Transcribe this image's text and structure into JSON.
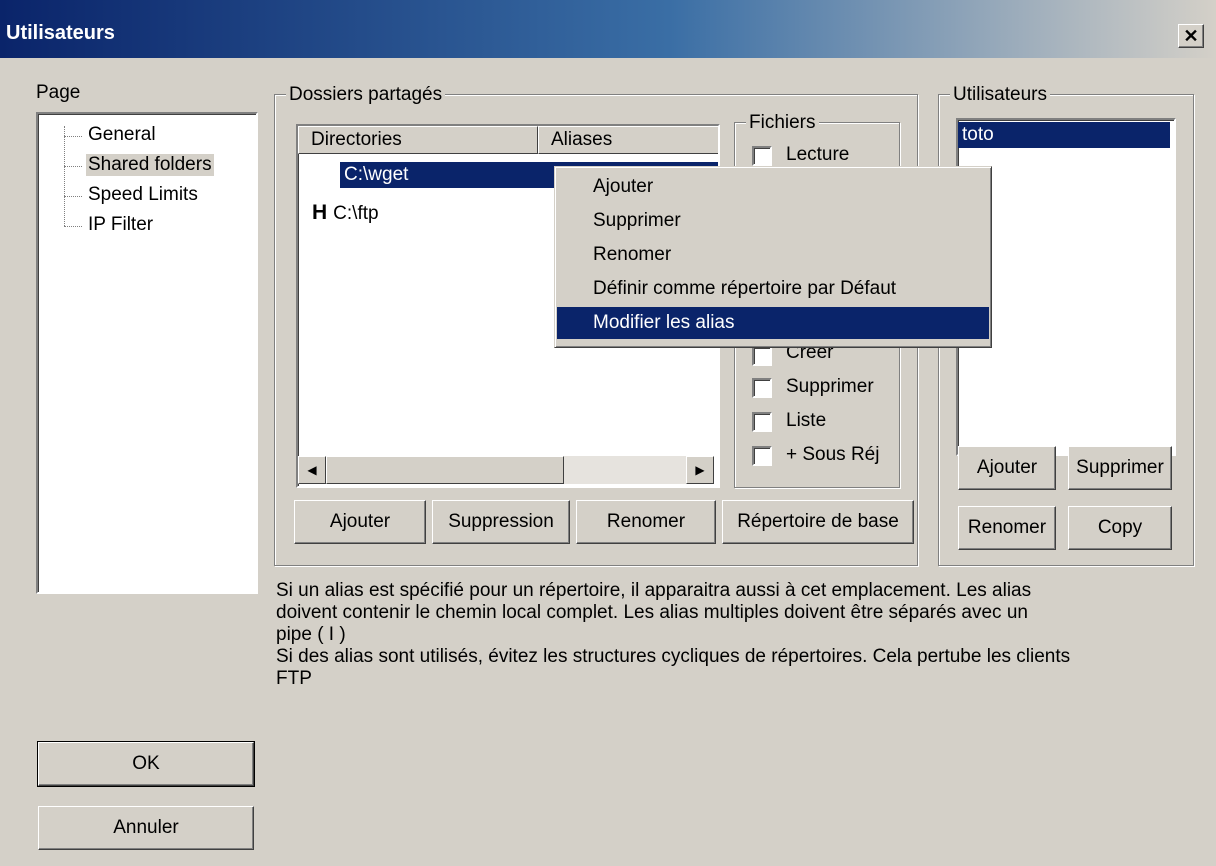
{
  "window": {
    "title": "Utilisateurs",
    "close_icon": "close-icon"
  },
  "page_panel": {
    "label": "Page",
    "items": [
      {
        "label": "General"
      },
      {
        "label": "Shared folders",
        "selected": true
      },
      {
        "label": "Speed Limits"
      },
      {
        "label": "IP Filter"
      }
    ]
  },
  "shared": {
    "group_label": "Dossiers partagés",
    "columns": [
      "Directories",
      "Aliases"
    ],
    "rows": [
      {
        "marker": "",
        "path": "C:\\wget",
        "selected": true
      },
      {
        "marker": "H",
        "path": "C:\\ftp"
      }
    ],
    "buttons": {
      "add": "Ajouter",
      "delete": "Suppression",
      "rename": "Renomer",
      "base": "Répertoire de base"
    }
  },
  "files": {
    "group_label": "Fichiers",
    "checkboxes": [
      {
        "label": "Lecture",
        "checked": false
      },
      {
        "label": "Creer",
        "checked": false
      },
      {
        "label": "Supprimer",
        "checked": false
      },
      {
        "label": "Liste",
        "checked": false
      },
      {
        "label": "+ Sous Réj",
        "checked": false
      }
    ]
  },
  "context_menu": {
    "items": [
      {
        "label": "Ajouter"
      },
      {
        "label": "Supprimer"
      },
      {
        "label": "Renomer"
      },
      {
        "label": "Définir comme répertoire par Défaut"
      },
      {
        "label": "Modifier les alias",
        "highlighted": true
      }
    ]
  },
  "users": {
    "group_label": "Utilisateurs",
    "list": [
      "toto"
    ],
    "buttons": {
      "add": "Ajouter",
      "delete": "Supprimer",
      "rename": "Renomer",
      "copy": "Copy"
    }
  },
  "info_text": {
    "line1": "Si un alias est spécifié pour un répertoire, il apparaitra aussi à cet emplacement. Les alias",
    "line2": "doivent contenir le chemin local complet. Les alias multiples doivent être séparés avec un",
    "line3": "pipe ( I )",
    "line4": "Si des alias sont utilisés, évitez les structures cycliques de répertoires. Cela pertube les clients",
    "line5": "FTP"
  },
  "footer": {
    "ok": "OK",
    "cancel": "Annuler"
  },
  "colors": {
    "title_bar": "#0a246a",
    "selection": "#0a246a",
    "face": "#d4d0c8"
  }
}
